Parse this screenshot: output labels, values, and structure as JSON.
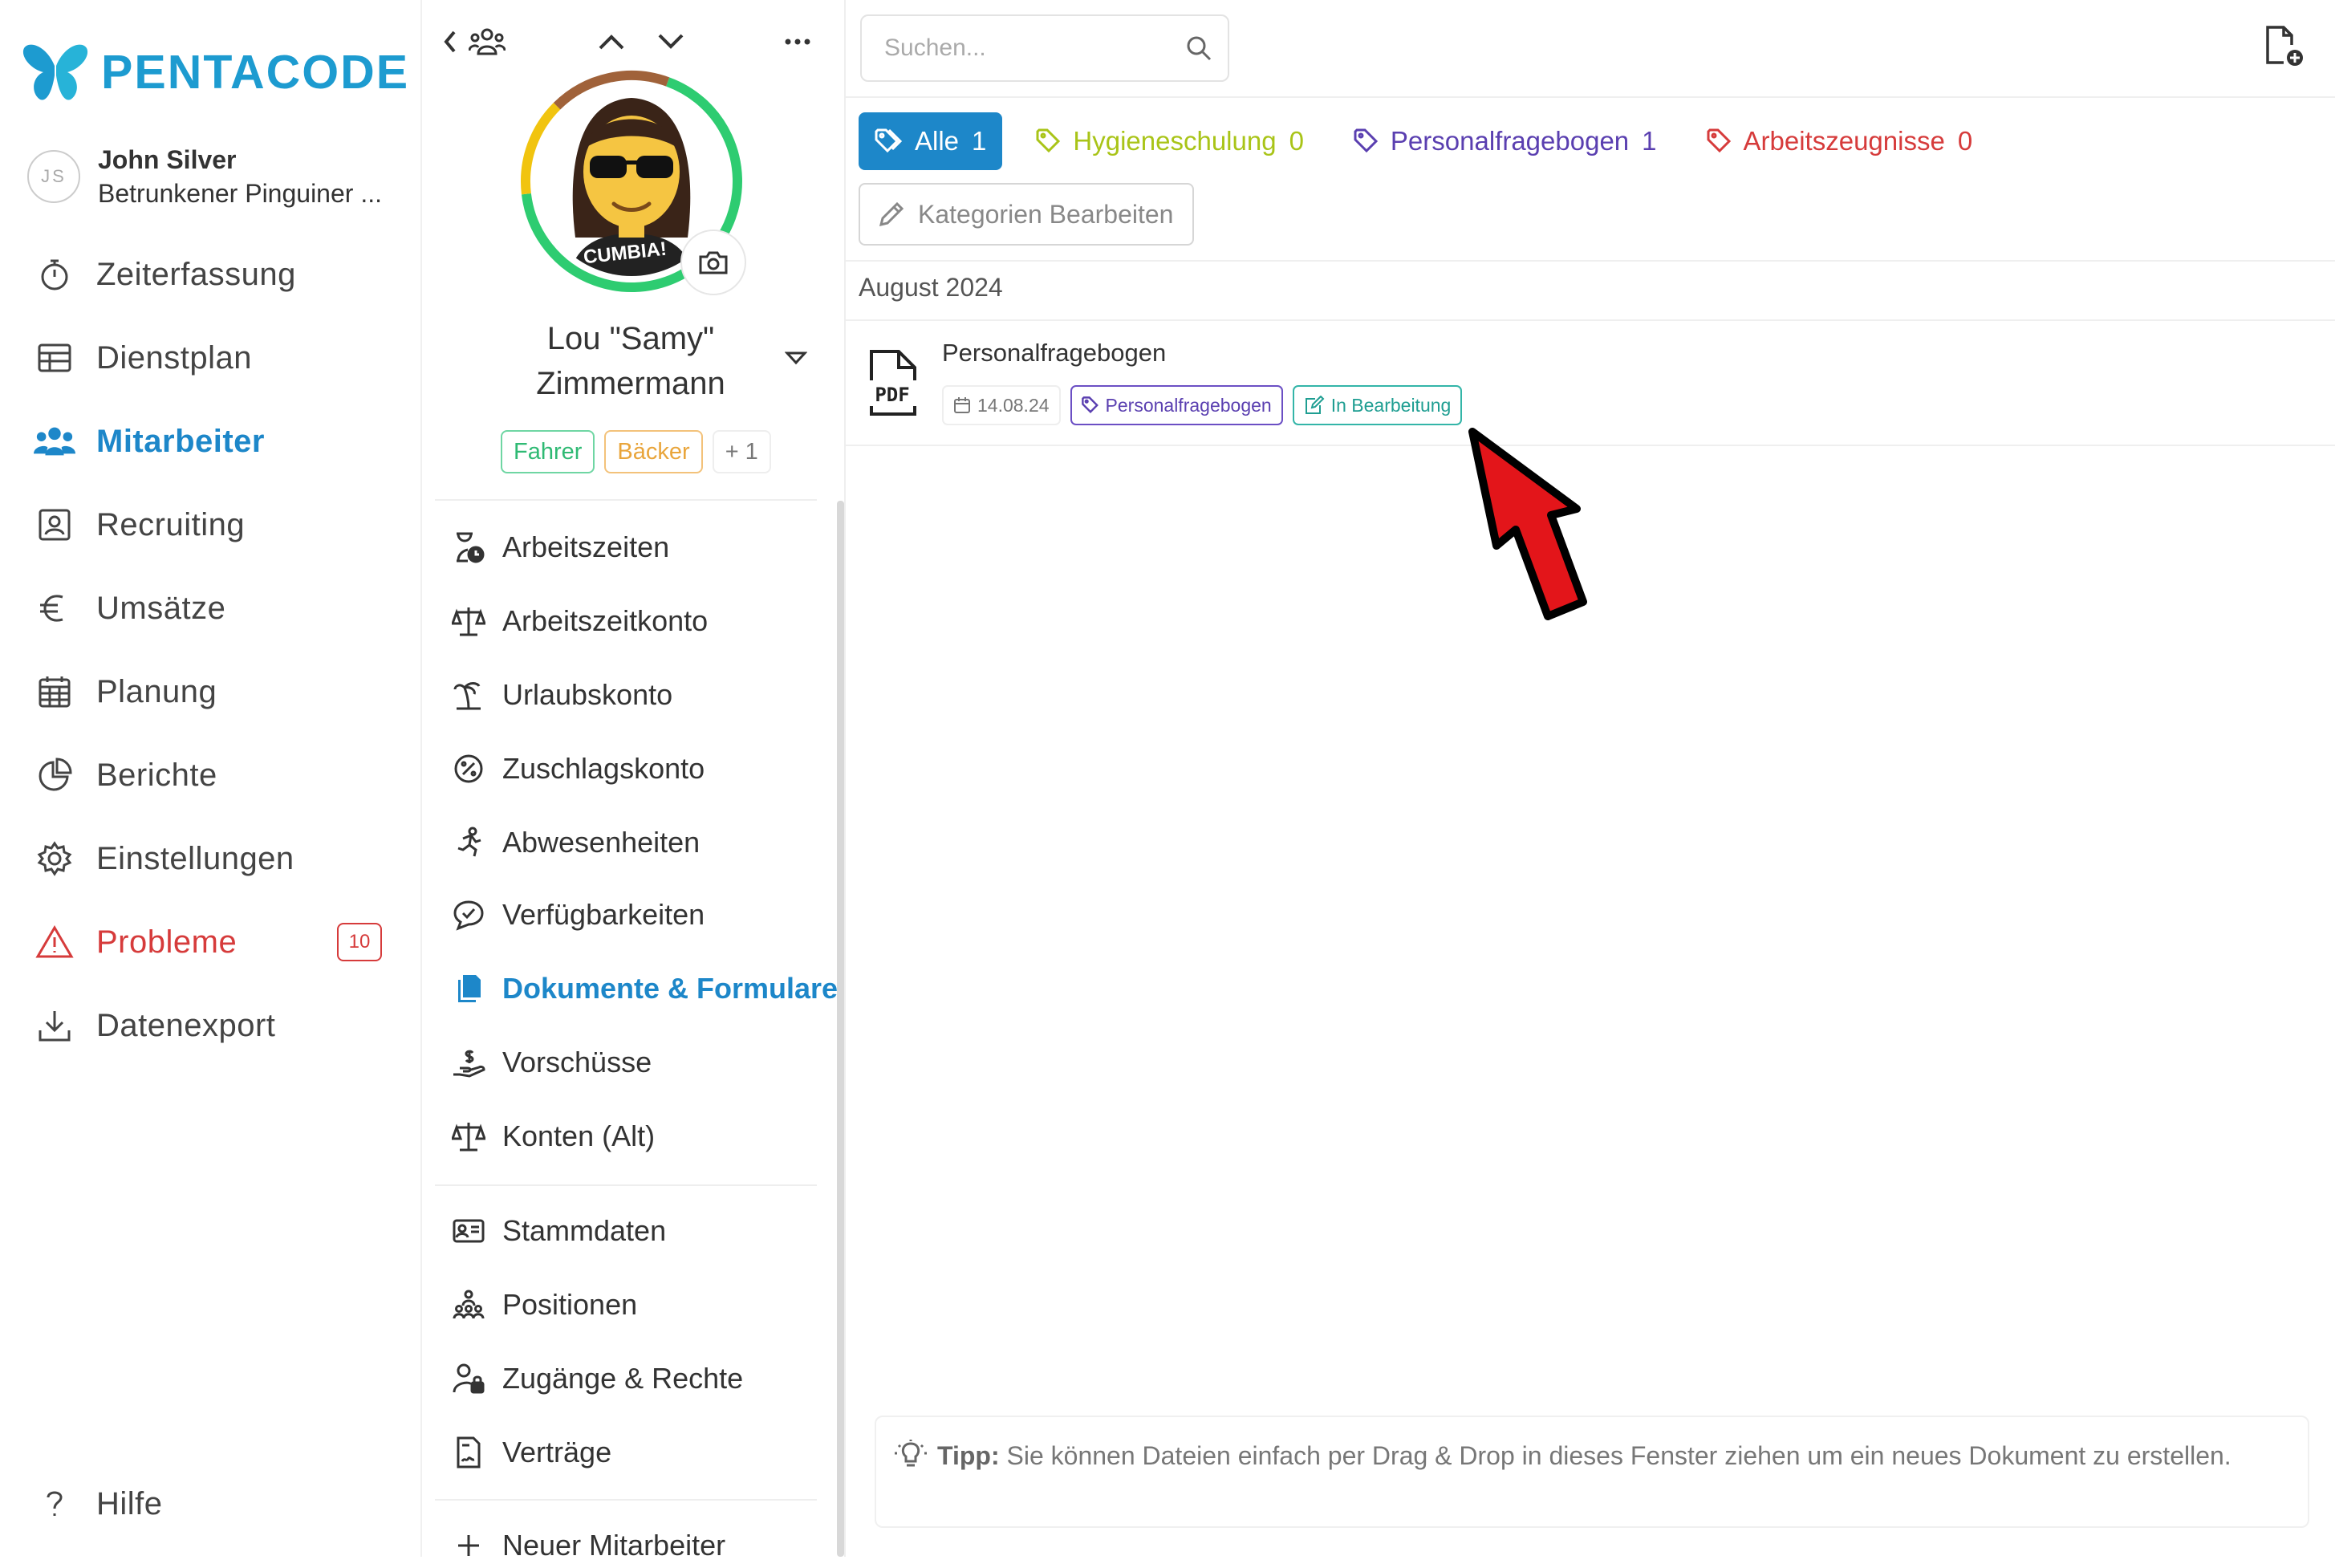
{
  "app": {
    "logo_text": "PENTACODE",
    "brand_color": "#1d9bd0"
  },
  "user": {
    "initials": "JS",
    "name": "John Silver",
    "company": "Betrunkener Pinguiner ..."
  },
  "nav": {
    "items": [
      {
        "label": "Zeiterfassung",
        "icon": "stopwatch-icon"
      },
      {
        "label": "Dienstplan",
        "icon": "table-icon"
      },
      {
        "label": "Mitarbeiter",
        "icon": "people-icon",
        "active": true
      },
      {
        "label": "Recruiting",
        "icon": "id-card-icon"
      },
      {
        "label": "Umsätze",
        "icon": "euro-icon"
      },
      {
        "label": "Planung",
        "icon": "calendar-icon"
      },
      {
        "label": "Berichte",
        "icon": "pie-chart-icon"
      },
      {
        "label": "Einstellungen",
        "icon": "gear-icon"
      },
      {
        "label": "Probleme",
        "icon": "warning-icon",
        "badge": "10"
      },
      {
        "label": "Datenexport",
        "icon": "download-icon"
      }
    ],
    "help_label": "Hilfe"
  },
  "employee": {
    "name_line1": "Lou \"Samy\"",
    "name_line2": "Zimmermann",
    "avatar_shirt_text": "CUMBIA!",
    "tags": [
      "Fahrer",
      "Bäcker",
      "+ 1"
    ]
  },
  "employee_menu": {
    "group1": [
      {
        "label": "Arbeitszeiten",
        "icon": "hourglass-clock-icon"
      },
      {
        "label": "Arbeitszeitkonto",
        "icon": "scale-icon"
      },
      {
        "label": "Urlaubskonto",
        "icon": "palm-tree-icon"
      },
      {
        "label": "Zuschlagskonto",
        "icon": "percent-badge-icon"
      },
      {
        "label": "Abwesenheiten",
        "icon": "running-person-icon"
      },
      {
        "label": "Verfügbarkeiten",
        "icon": "check-bubble-icon"
      },
      {
        "label": "Dokumente & Formulare",
        "icon": "documents-icon",
        "active": true
      },
      {
        "label": "Vorschüsse",
        "icon": "hand-money-icon"
      },
      {
        "label": "Konten (Alt)",
        "icon": "scale-icon"
      }
    ],
    "group2": [
      {
        "label": "Stammdaten",
        "icon": "id-card-icon"
      },
      {
        "label": "Positionen",
        "icon": "people-group-icon"
      },
      {
        "label": "Zugänge & Rechte",
        "icon": "user-lock-icon"
      },
      {
        "label": "Verträge",
        "icon": "contract-icon"
      }
    ],
    "new_employee": "Neuer Mitarbeiter"
  },
  "documents": {
    "search_placeholder": "Suchen...",
    "filters": [
      {
        "label": "Alle",
        "count": "1",
        "color": "#1d87c9"
      },
      {
        "label": "Hygieneschulung",
        "count": "0",
        "color": "#a9c418"
      },
      {
        "label": "Personalfragebogen",
        "count": "1",
        "color": "#5a3fb0"
      },
      {
        "label": "Arbeitszeugnisse",
        "count": "0",
        "color": "#d63b3b"
      }
    ],
    "edit_categories_label": "Kategorien Bearbeiten",
    "month_heading": "August 2024",
    "items": [
      {
        "title": "Personalfragebogen",
        "file_icon_text": "PDF",
        "date": "14.08.24",
        "category": "Personalfragebogen",
        "status": "In Bearbeitung"
      }
    ],
    "tip_label": "Tipp:",
    "tip_text": "Sie können Dateien einfach per Drag & Drop in dieses Fenster ziehen um ein neues Dokument zu erstellen."
  }
}
